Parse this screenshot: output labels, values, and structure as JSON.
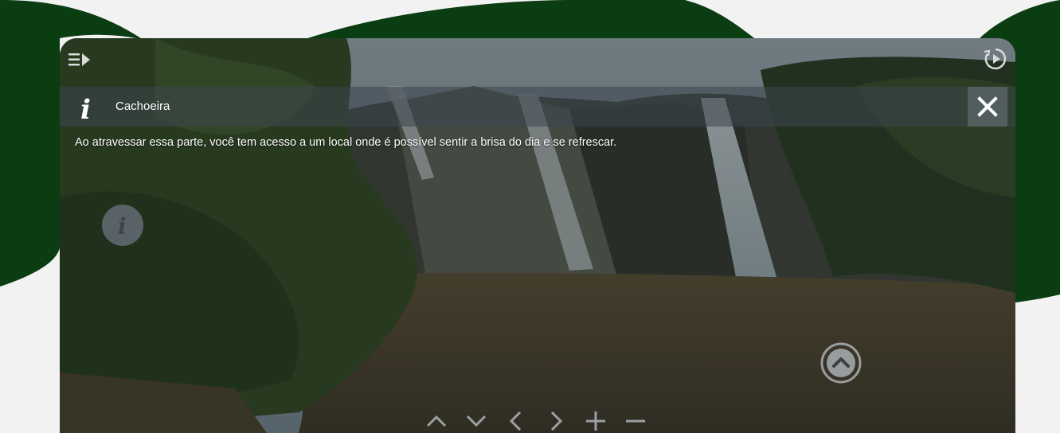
{
  "panel": {
    "title": "Cachoeira",
    "description": "Ao atravessar essa parte, você tem acesso a um local onde é possível sentir a brisa do dia e se refrescar."
  },
  "icons": {
    "top_left": "menu-list-icon",
    "top_right": "autoplay-icon",
    "panel": "info-icon",
    "close": "close-icon",
    "hotspot": "info-hotspot-icon",
    "navigate": "navigate-up-icon",
    "controls": [
      "chevron-up-icon",
      "chevron-down-icon",
      "chevron-left-icon",
      "chevron-right-icon",
      "zoom-in-icon",
      "zoom-out-icon"
    ]
  },
  "colors": {
    "page_background": "#f2f2f2",
    "decor_green": "#0b3d12",
    "icon_white": "#ffffff"
  }
}
